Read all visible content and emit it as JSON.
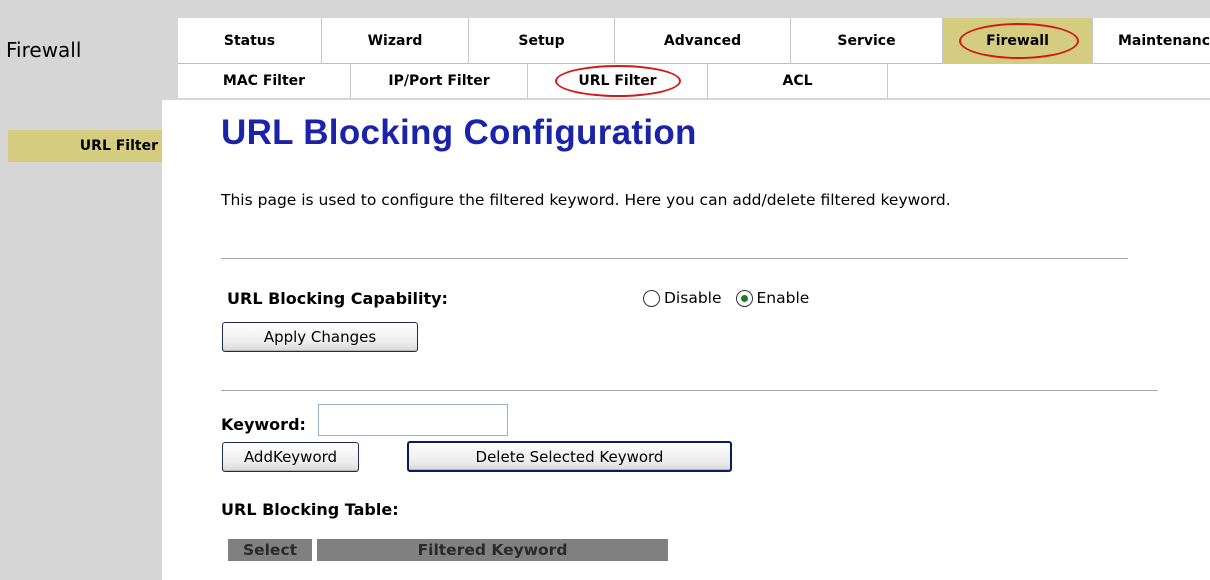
{
  "header": {
    "section_title": "Firewall",
    "main_tabs": [
      {
        "label": "Status"
      },
      {
        "label": "Wizard"
      },
      {
        "label": "Setup"
      },
      {
        "label": "Advanced"
      },
      {
        "label": "Service"
      },
      {
        "label": "Firewall",
        "active": true,
        "circled": true
      },
      {
        "label": "Maintenance"
      }
    ],
    "sub_tabs": [
      {
        "label": "MAC Filter"
      },
      {
        "label": "IP/Port Filter"
      },
      {
        "label": "URL Filter",
        "active": true,
        "circled": true
      },
      {
        "label": "ACL"
      }
    ]
  },
  "sidebar": {
    "items": [
      {
        "label": "URL Filter",
        "active": true
      }
    ]
  },
  "main": {
    "title": "URL Blocking Configuration",
    "description": "This page is used to configure the filtered keyword. Here you can add/delete filtered keyword.",
    "capability": {
      "label": "URL Blocking Capability:",
      "options": [
        {
          "label": "Disable",
          "selected": false
        },
        {
          "label": "Enable",
          "selected": true
        }
      ]
    },
    "apply_button": "Apply Changes",
    "keyword": {
      "label": "Keyword:",
      "value": "",
      "placeholder": ""
    },
    "add_button": "AddKeyword",
    "delete_button": "Delete Selected Keyword",
    "table": {
      "title": "URL Blocking Table:",
      "columns": [
        "Select",
        "Filtered Keyword"
      ],
      "rows": []
    }
  },
  "colors": {
    "header_bg": "#d6d6d6",
    "active_tab_bg": "#d4cd7f",
    "title_blue": "#1b23a8",
    "annotation_red": "#d21818",
    "table_header_bg": "#808080"
  }
}
